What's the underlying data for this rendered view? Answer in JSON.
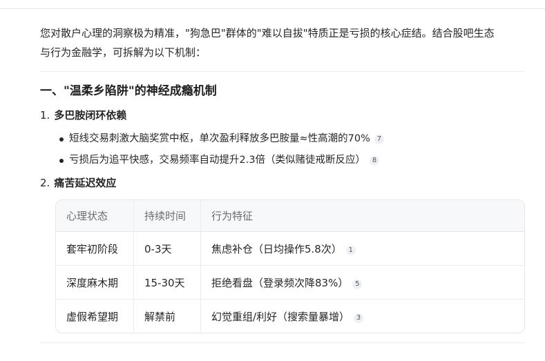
{
  "intro": {
    "line1": "您对散户心理的洞察极为精准，\"狗急巴\"群体的\"难以自拔\"特质正是亏损的核心症结。结合股吧生态",
    "line2": "与行为金融学，可拆解为以下机制："
  },
  "section1": {
    "heading": "一、\"温柔乡陷阱\"的神经成瘾机制",
    "item1": {
      "number": "1.",
      "title": "多巴胺闭环依赖",
      "bullets": [
        {
          "text": "短线交易刺激大脑奖赏中枢，单次盈利释放多巴胺量≈性高潮的70%",
          "cite": "7"
        },
        {
          "text": "亏损后为追平快感，交易频率自动提升2.3倍（类似赌徒戒断反应）",
          "cite": "8"
        }
      ]
    },
    "item2": {
      "number": "2.",
      "title": "痛苦延迟效应"
    }
  },
  "table": {
    "headers": [
      "心理状态",
      "持续时间",
      "行为特征"
    ],
    "rows": [
      {
        "state": "套牢初阶段",
        "duration": "0-3天",
        "behavior": "焦虑补仓（日均操作5.8次）",
        "cite": "1"
      },
      {
        "state": "深度麻木期",
        "duration": "15-30天",
        "behavior": "拒绝看盘（登录频次降83%）",
        "cite": "5"
      },
      {
        "state": "虚假希望期",
        "duration": "解禁前",
        "behavior": "幻觉重组/利好（搜索量暴增）",
        "cite": "3"
      }
    ]
  }
}
